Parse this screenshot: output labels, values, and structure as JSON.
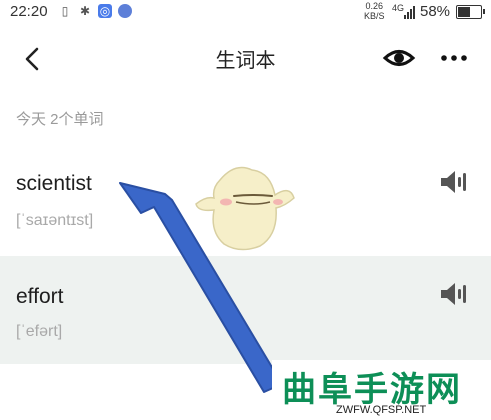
{
  "status_bar": {
    "time": "22:20",
    "net_speed_value": "0.26",
    "net_speed_unit": "KB/S",
    "signal_type": "4G",
    "battery": "58%",
    "battery_level": 0.58
  },
  "header": {
    "title": "生词本"
  },
  "summary": "今天 2个单词",
  "words": [
    {
      "word": "scientist",
      "phonetic": "[ˈsaɪəntɪst]"
    },
    {
      "word": "effort",
      "phonetic": "[ˈefərt]"
    }
  ],
  "watermark": {
    "title": "曲阜手游网",
    "url": "ZWFW.QFSP.NET"
  },
  "colors": {
    "arrow": "#3a67c9",
    "watermark": "#0d8f57",
    "highlight_row": "#eef2f0"
  }
}
